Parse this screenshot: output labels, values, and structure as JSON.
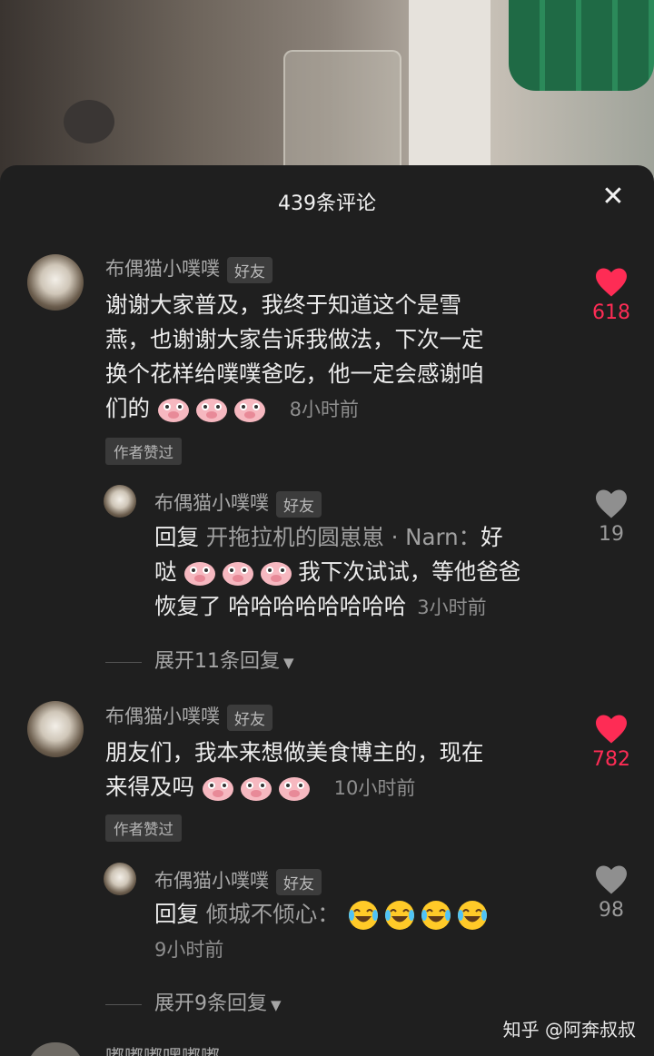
{
  "header": {
    "title": "439条评论",
    "close_icon": "✕"
  },
  "comments": [
    {
      "user": "布偶猫小噗噗",
      "badge": "好友",
      "line1": "谢谢大家普及，我终于知道这个是雪",
      "line2": "燕，也谢谢大家告诉我做法，下次一定",
      "line3": "换个花样给噗噗爸吃，他一定会感谢咱",
      "line4_prefix": "们的",
      "time": "8小时前",
      "author_liked": "作者赞过",
      "likes": "618",
      "reply": {
        "user": "布偶猫小噗噗",
        "badge": "好友",
        "reply_kw": "回复",
        "target": "开拖拉机的圆崽崽 · Narn：",
        "line1_tail": "好",
        "line2_head": "哒",
        "line2_tail": "我下次试试，等他爸爸",
        "line3": "恢复了 哈哈哈哈哈哈哈哈",
        "time": "3小时前",
        "likes": "19"
      },
      "expand": "展开11条回复"
    },
    {
      "user": "布偶猫小噗噗",
      "badge": "好友",
      "line1": "朋友们，我本来想做美食博主的，现在",
      "line2_prefix": "来得及吗",
      "time": "10小时前",
      "author_liked": "作者赞过",
      "likes": "782",
      "reply": {
        "user": "布偶猫小噗噗",
        "badge": "好友",
        "reply_kw": "回复",
        "target": "倾城不倾心：",
        "time": "9小时前",
        "likes": "98"
      },
      "expand": "展开9条回复"
    }
  ],
  "next_user_partial": "嘟嘟嘟嘿嘟嘟",
  "watermark": "知乎 @阿奔叔叔",
  "colors": {
    "like_red": "#fe2c55",
    "sheet_bg": "#1f1f1f",
    "muted": "#8e8e8e"
  }
}
